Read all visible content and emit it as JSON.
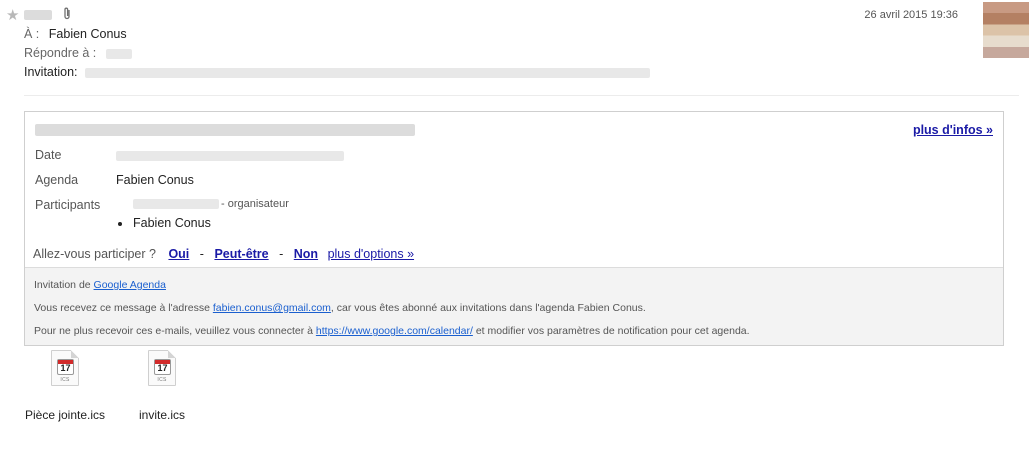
{
  "header": {
    "star_icon": "star-icon",
    "attachment_icon": "paperclip-icon",
    "date": "26 avril 2015 19:36",
    "to_label": "À :",
    "to_value": "Fabien Conus",
    "reply_label": "Répondre à :",
    "subject_label": "Invitation:"
  },
  "invite": {
    "more_info": "plus d'infos »",
    "date_label": "Date",
    "agenda_label": "Agenda",
    "agenda_value": "Fabien Conus",
    "participants_label": "Participants",
    "organizer_suffix": "- organisateur",
    "participant": "Fabien Conus",
    "rsvp_question": "Allez-vous participer ?",
    "rsvp_yes": "Oui",
    "rsvp_maybe": "Peut-être",
    "rsvp_no": "Non",
    "rsvp_separator": "-",
    "more_options": "plus d'options »"
  },
  "footer": {
    "line1_prefix": "Invitation de",
    "line1_link": "Google Agenda",
    "line2_prefix": "Vous recevez ce message à l'adresse",
    "line2_email": "fabien.conus@gmail.com",
    "line2_suffix": ", car vous êtes abonné aux invitations dans l'agenda Fabien Conus.",
    "line3_prefix": "Pour ne plus recevoir ces e-mails, veuillez vous connecter à",
    "line3_link": "https://www.google.com/calendar/",
    "line3_suffix": "et modifier vos paramètres de notification pour cet agenda."
  },
  "attachments": [
    {
      "name": "Pièce jointe.ics",
      "day": "17",
      "ext": "ICS"
    },
    {
      "name": "invite.ics",
      "day": "17",
      "ext": "ICS"
    }
  ],
  "colors": {
    "link": "#1a1aa6",
    "footer_link": "#1a5fcf",
    "footer_bg": "#f3f3f3",
    "calendar_red": "#d22a2a"
  }
}
